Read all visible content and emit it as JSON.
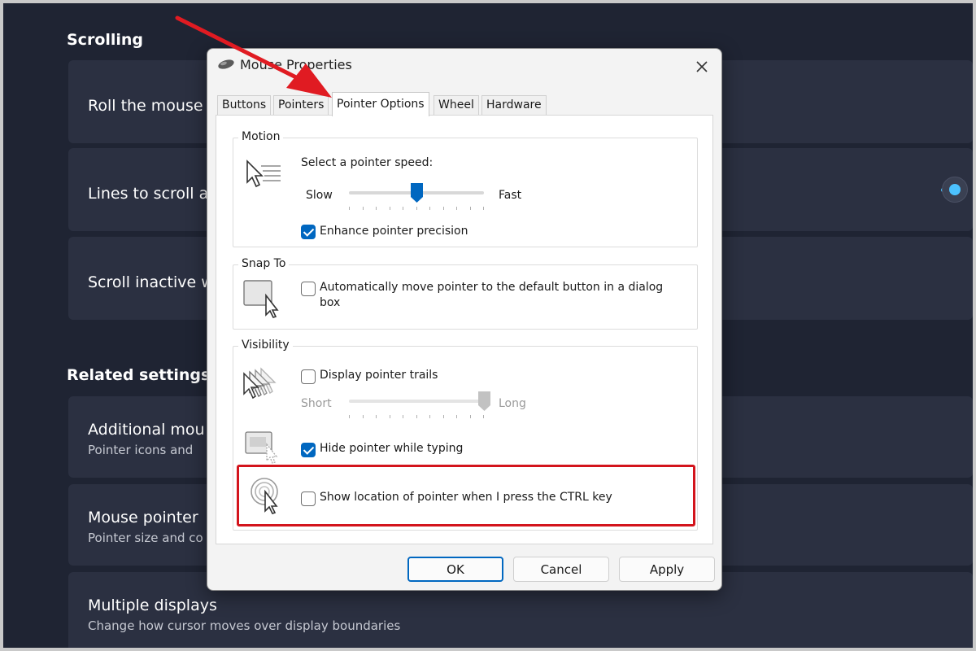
{
  "settings": {
    "scrolling_heading": "Scrolling",
    "roll_mouse": "Roll the mouse",
    "lines_to_scroll": "Lines to scroll at",
    "scroll_inactive": "Scroll inactive w",
    "related_heading": "Related settings",
    "additional_mouse": {
      "title": "Additional mou",
      "sub": "Pointer icons and"
    },
    "mouse_pointer": {
      "title": "Mouse pointer",
      "sub": "Pointer size and co"
    },
    "multiple_displays": {
      "title": "Multiple displays",
      "sub": "Change how cursor moves over display boundaries"
    }
  },
  "dialog": {
    "title": "Mouse Properties",
    "tabs": [
      "Buttons",
      "Pointers",
      "Pointer Options",
      "Wheel",
      "Hardware"
    ],
    "active_tab": "Pointer Options",
    "motion": {
      "legend": "Motion",
      "speed_label": "Select a pointer speed:",
      "slow_label": "Slow",
      "fast_label": "Fast",
      "speed_fraction": 0.5,
      "precision_label": "Enhance pointer precision",
      "precision_checked": true
    },
    "snap_to": {
      "legend": "Snap To",
      "auto_move_label_1": "Automatically move pointer to the default button in a dialog",
      "auto_move_label_2": "box",
      "auto_move_checked": false
    },
    "visibility": {
      "legend": "Visibility",
      "trails_label": "Display pointer trails",
      "trails_checked": false,
      "short_label": "Short",
      "long_label": "Long",
      "trails_fraction": 1.0,
      "hide_label": "Hide pointer while typing",
      "hide_checked": true,
      "ctrl_label": "Show location of pointer when I press the CTRL key",
      "ctrl_checked": false
    },
    "buttons": {
      "ok": "OK",
      "cancel": "Cancel",
      "apply": "Apply"
    }
  },
  "colors": {
    "accent": "#0067c0",
    "highlight": "#d3141c",
    "bg_app": "#1f2433"
  }
}
